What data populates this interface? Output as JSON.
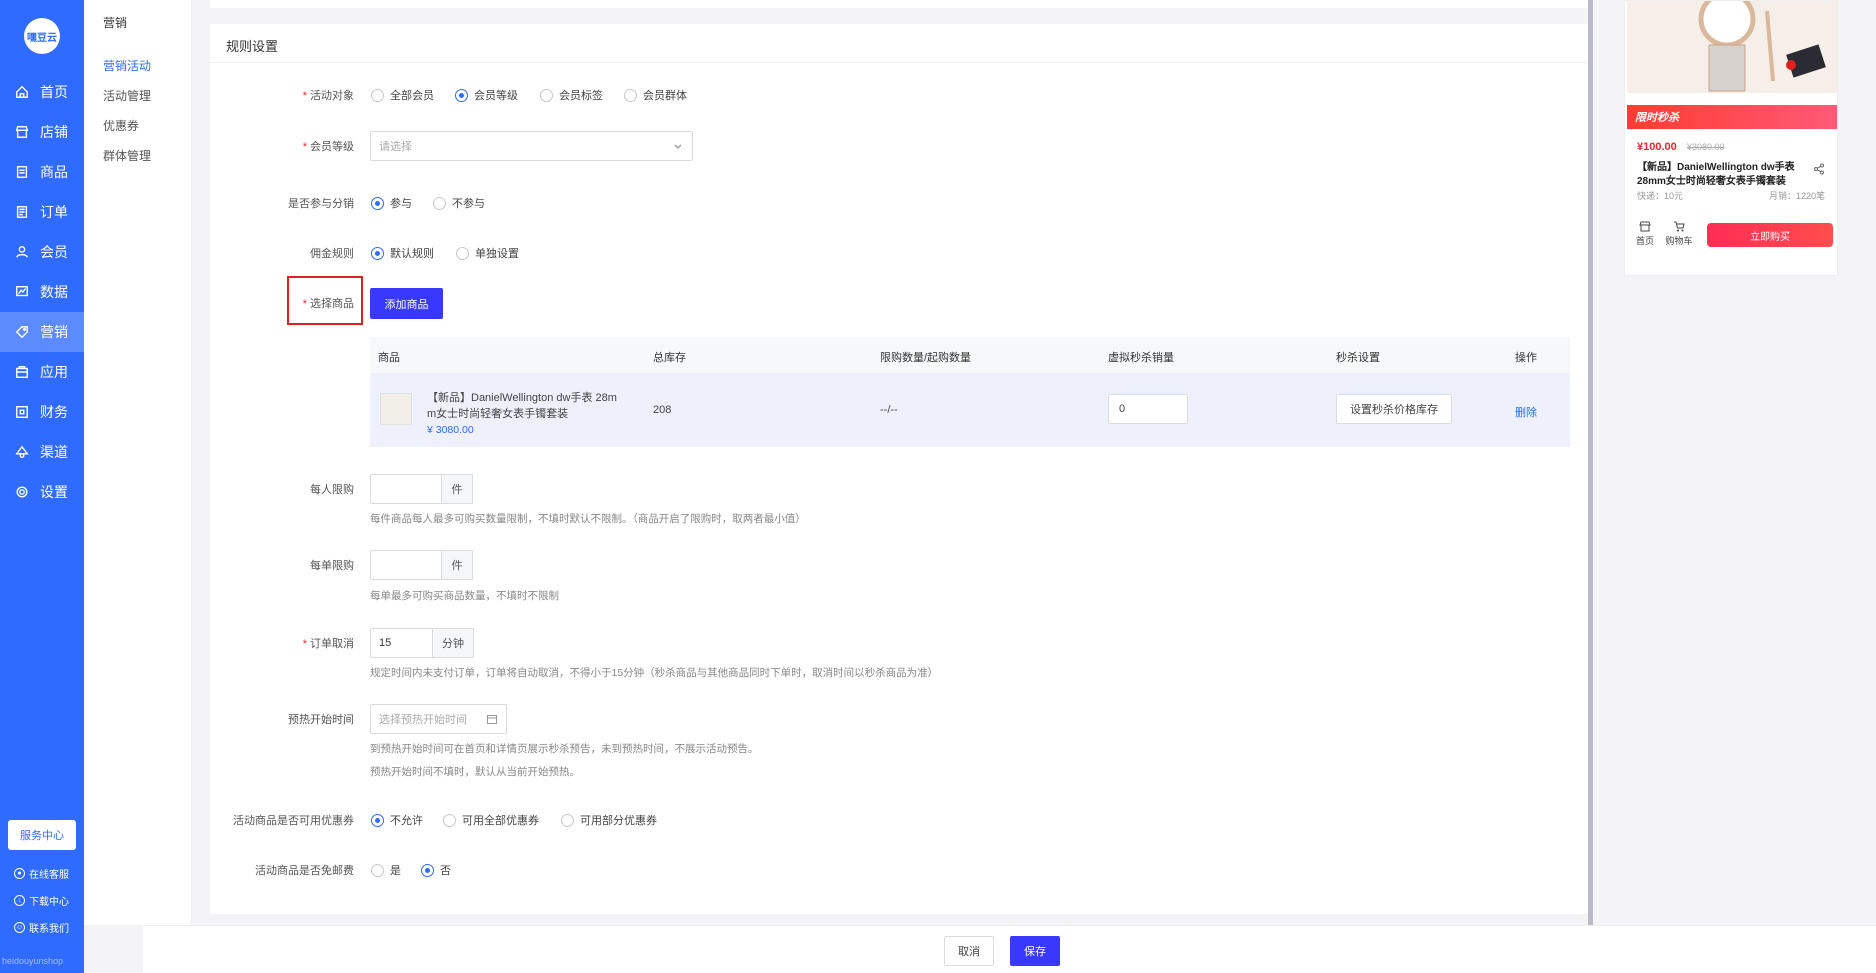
{
  "sidebar": {
    "logo": "嘿豆云",
    "items": [
      {
        "label": "首页",
        "icon": "home-icon"
      },
      {
        "label": "店铺",
        "icon": "store-icon"
      },
      {
        "label": "商品",
        "icon": "goods-icon"
      },
      {
        "label": "订单",
        "icon": "order-icon"
      },
      {
        "label": "会员",
        "icon": "member-icon"
      },
      {
        "label": "数据",
        "icon": "chart-icon"
      },
      {
        "label": "营销",
        "icon": "tag-icon"
      },
      {
        "label": "应用",
        "icon": "app-icon"
      },
      {
        "label": "财务",
        "icon": "finance-icon"
      },
      {
        "label": "渠道",
        "icon": "channel-icon"
      },
      {
        "label": "设置",
        "icon": "gear-icon"
      }
    ],
    "service_center": "服务中心",
    "links": [
      "在线客服",
      "下载中心",
      "联系我们"
    ],
    "footer": "heidouyunshop"
  },
  "submenu": {
    "title": "营销",
    "items": [
      "营销活动",
      "活动管理",
      "优惠券",
      "群体管理"
    ]
  },
  "form": {
    "section_title": "规则设置",
    "activity_target": {
      "label": "活动对象",
      "options": [
        "全部会员",
        "会员等级",
        "会员标签",
        "会员群体"
      ],
      "selected": "会员等级"
    },
    "member_level": {
      "label": "会员等级",
      "placeholder": "请选择"
    },
    "distribution": {
      "label": "是否参与分销",
      "options": [
        "参与",
        "不参与"
      ],
      "selected": "参与"
    },
    "commission": {
      "label": "佣金规则",
      "options": [
        "默认规则",
        "单独设置"
      ],
      "selected": "默认规则"
    },
    "select_goods": {
      "label": "选择商品",
      "button": "添加商品"
    },
    "goods_table": {
      "headers": [
        "商品",
        "总库存",
        "限购数量/起购数量",
        "虚拟秒杀销量",
        "秒杀设置",
        "操作"
      ],
      "row": {
        "name_line1": "【新品】DanielWellington dw手表 28m",
        "name_line2": "m女士时尚轻奢女表手镯套装",
        "price": "¥ 3080.00",
        "stock": "208",
        "limit": "--/--",
        "virtual_sales": "0",
        "setting_button": "设置秒杀价格库存",
        "action": "删除"
      }
    },
    "per_person_limit": {
      "label": "每人限购",
      "unit": "件",
      "hint": "每件商品每人最多可购买数量限制，不填时默认不限制。（商品开启了限购时，取两者最小值）"
    },
    "per_order_limit": {
      "label": "每单限购",
      "unit": "件",
      "hint": "每单最多可购买商品数量，不填时不限制"
    },
    "order_cancel": {
      "label": "订单取消",
      "value": "15",
      "unit": "分钟",
      "hint": "规定时间内未支付订单，订单将自动取消，不得小于15分钟（秒杀商品与其他商品同时下单时，取消时间以秒杀商品为准）"
    },
    "preheat": {
      "label": "预热开始时间",
      "placeholder": "选择预热开始时间",
      "hint1": "到预热开始时间可在首页和详情页展示秒杀预告，未到预热时间，不展示活动预告。",
      "hint2": "预热开始时间不填时，默认从当前开始预热。"
    },
    "coupon": {
      "label": "活动商品是否可用优惠券",
      "options": [
        "不允许",
        "可用全部优惠券",
        "可用部分优惠券"
      ],
      "selected": "不允许"
    },
    "free_shipping": {
      "label": "活动商品是否免邮费",
      "options": [
        "是",
        "否"
      ],
      "selected": "否"
    }
  },
  "preview": {
    "flash_tag": "限时秒杀",
    "price": "¥100.00",
    "original_price": "¥3080.00",
    "title": "【新品】DanielWellington dw手表28mm女士时尚轻奢女表手镯套装",
    "shipping": "快递：10元",
    "sold": "月销：1220笔",
    "nav_home": "首页",
    "nav_cart": "购物车",
    "buy_button": "立即购买"
  },
  "footer": {
    "cancel": "取消",
    "save": "保存"
  },
  "colors": {
    "primary": "#2f6bff",
    "button": "#3838ff",
    "danger": "#f5222d"
  }
}
